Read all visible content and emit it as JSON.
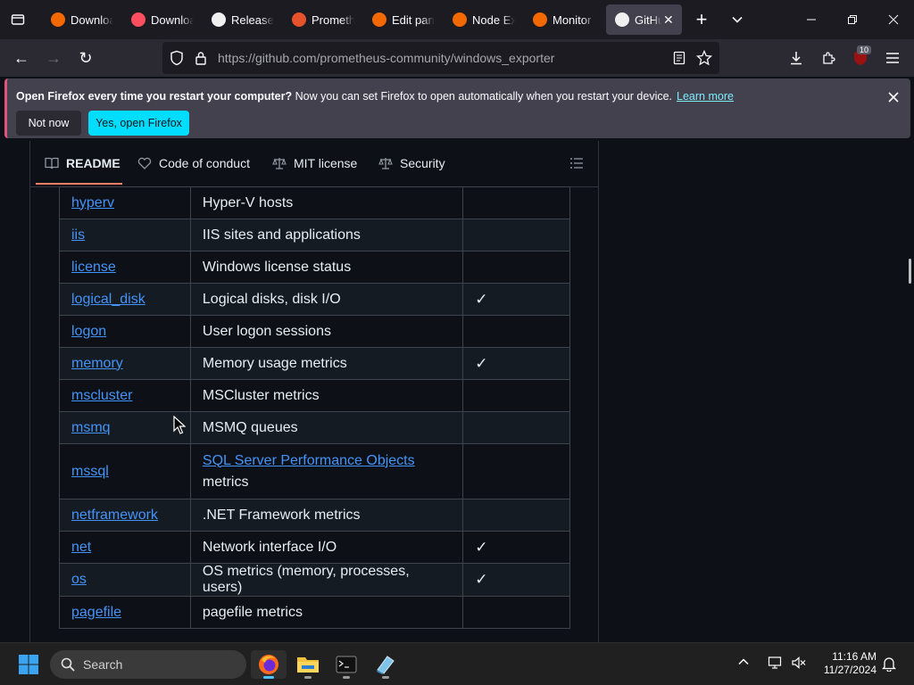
{
  "browser": {
    "tabs": [
      {
        "label": "Download",
        "icon": "grafana-icon"
      },
      {
        "label": "Download",
        "icon": "firefox-account-icon"
      },
      {
        "label": "Release",
        "icon": "github-icon"
      },
      {
        "label": "Prometheus",
        "icon": "prometheus-icon"
      },
      {
        "label": "Edit panel",
        "icon": "grafana-icon"
      },
      {
        "label": "Node Exporter",
        "icon": "grafana-icon"
      },
      {
        "label": "Monitor",
        "icon": "grafana-icon"
      },
      {
        "label": "GitHub",
        "icon": "github-icon",
        "active": true
      }
    ],
    "url_host": "https://github.com",
    "url_path": "/prometheus-community/windows_exporter",
    "extensions_badge": "10"
  },
  "notification": {
    "bold": "Open Firefox every time you restart your computer?",
    "text": " Now you can set Firefox to open automatically when you restart your device.",
    "link": "Learn more",
    "not_now": "Not now",
    "yes": "Yes, open Firefox"
  },
  "readme_tabs": {
    "readme": "README",
    "conduct": "Code of conduct",
    "license": "MIT license",
    "security": "Security"
  },
  "collectors": [
    {
      "name": "hyperv",
      "desc": "Hyper-V hosts",
      "default": ""
    },
    {
      "name": "iis",
      "desc": "IIS sites and applications",
      "default": ""
    },
    {
      "name": "license",
      "desc": "Windows license status",
      "default": ""
    },
    {
      "name": "logical_disk",
      "desc": "Logical disks, disk I/O",
      "default": "✓"
    },
    {
      "name": "logon",
      "desc": "User logon sessions",
      "default": ""
    },
    {
      "name": "memory",
      "desc": "Memory usage metrics",
      "default": "✓"
    },
    {
      "name": "mscluster",
      "desc": "MSCluster metrics",
      "default": ""
    },
    {
      "name": "msmq",
      "desc": "MSMQ queues",
      "default": ""
    },
    {
      "name": "mssql",
      "desc_link": "SQL Server Performance Objects",
      "desc_after": "metrics",
      "default": ""
    },
    {
      "name": "netframework",
      "desc": ".NET Framework metrics",
      "default": ""
    },
    {
      "name": "net",
      "desc": "Network interface I/O",
      "default": "✓"
    },
    {
      "name": "os",
      "desc": "OS metrics (memory, processes, users)",
      "default": "✓"
    },
    {
      "name": "pagefile",
      "desc": "pagefile metrics",
      "default": ""
    }
  ],
  "taskbar": {
    "search_placeholder": "Search",
    "time": "11:16 AM",
    "date": "11/27/2024"
  }
}
